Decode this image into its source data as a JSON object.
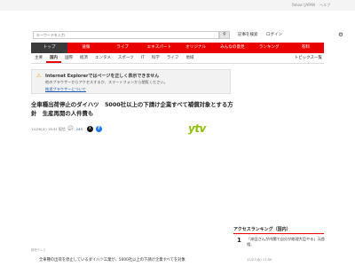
{
  "topbar": {
    "links": [
      "Yahoo! JAPAN",
      "ヘルプ"
    ]
  },
  "search": {
    "placeholder": "キーワードを入力",
    "button_icon": "search-icon",
    "links": [
      "記事を検索",
      "ログイン"
    ]
  },
  "mainnav": {
    "items": [
      "トップ",
      "速報",
      "ライブ",
      "エキスパート",
      "オリジナル",
      "みんなの意見",
      "ランキング",
      "有料"
    ],
    "active_index": 0,
    "colors": {
      "bar": "#e90000",
      "active": "#3b3b3b"
    }
  },
  "subnav": {
    "items": [
      "主要",
      "国内",
      "国際",
      "経済",
      "エンタメ",
      "スポーツ",
      "IT",
      "科学",
      "ライフ",
      "地域"
    ],
    "active_index": 1,
    "right_label": "トピックス一覧"
  },
  "warning": {
    "icon": "warning-icon",
    "title": "Internet Explorerではページを正しく表示できません",
    "text": "他のブラウザーからアクセスするか、スマートフォンから閲覧ください。",
    "link": "推奨ブラウザーについて"
  },
  "article": {
    "headline": "全車種出荷停止のダイハツ　5000社以上の下請け企業すべて補償対象とする方針　生産再開の人件費も",
    "date": "12/26(火) 18:31 配信",
    "comments": "243",
    "source_logo": "ytv",
    "caption": "読売テレビ",
    "body": "全車種の出荷を停止しているダイハツ工業が、5000社以上の下請け企業すべてを対象"
  },
  "sidebar": {
    "ranking_title": "アクセスランキング（国内）",
    "items": [
      {
        "rank": "1",
        "text": "「岸田さんが内閣で自分が総理大臣やる」元首相、",
        "source": "12/27(水) 17:30"
      }
    ]
  }
}
